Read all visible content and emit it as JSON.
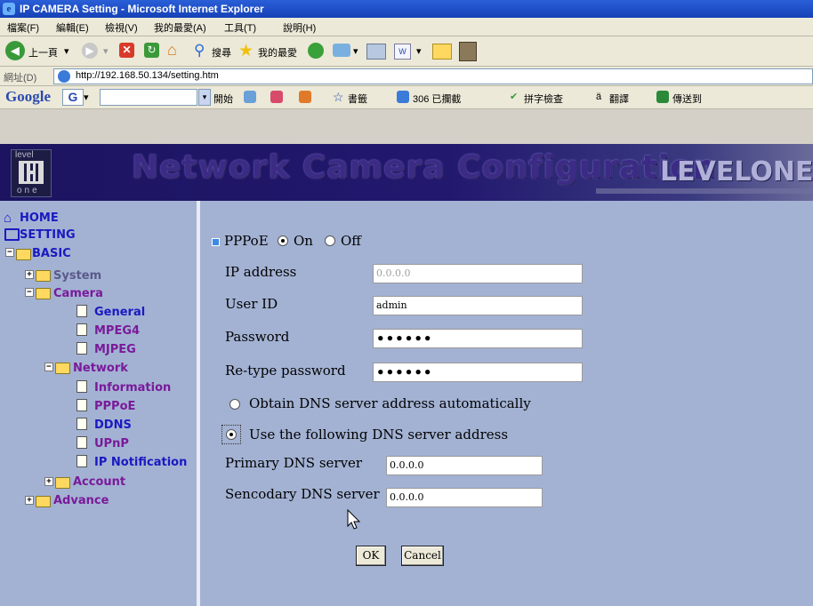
{
  "window": {
    "title": "IP CAMERA Setting - Microsoft Internet Explorer"
  },
  "menu": [
    "檔案(F)",
    "編輯(E)",
    "檢視(V)",
    "我的最愛(A)",
    "工具(T)",
    "說明(H)"
  ],
  "toolbar": {
    "back": "上一頁",
    "search": "搜尋",
    "favorites": "我的最愛"
  },
  "address": {
    "label": "網址(D)",
    "url": "http://192.168.50.134/setting.htm"
  },
  "google_bar": {
    "logo": "Google",
    "g_button": "G",
    "start": "開始",
    "bookmarks": "書籤",
    "blocked": "306 已攔截",
    "spell": "拼字檢查",
    "translate": "翻譯",
    "send": "傳送到"
  },
  "banner": {
    "logo_top": "level",
    "logo_bottom": "one",
    "title": "Network Camera Configuration",
    "brand": "LEVELONE"
  },
  "sidebar": {
    "home": "HOME",
    "setting": "SETTING",
    "basic": "BASIC",
    "system": "System",
    "camera": "Camera",
    "general": "General",
    "mpeg4": "MPEG4",
    "mjpeg": "MJPEG",
    "network": "Network",
    "information": "Information",
    "pppoe": "PPPoE",
    "ddns": "DDNS",
    "upnp": "UPnP",
    "ip_notification": "IP Notification",
    "account": "Account",
    "advance": "Advance"
  },
  "form": {
    "pppoe_label": "PPPoE",
    "on": "On",
    "off": "Off",
    "ip_label": "IP address",
    "ip_value": "0.0.0.0",
    "user_label": "User ID",
    "user_value": "admin",
    "password_label": "Password",
    "password_value": "••••••",
    "retype_label": "Re-type password",
    "retype_value": "••••••",
    "dns_auto": "Obtain DNS server address automatically",
    "dns_manual": "Use the following DNS server address",
    "primary_label": "Primary DNS server",
    "primary_value": "0.0.0.0",
    "secondary_label": "Sencodary DNS server",
    "secondary_value": "0.0.0.0",
    "ok": "OK",
    "cancel": "Cancel"
  }
}
